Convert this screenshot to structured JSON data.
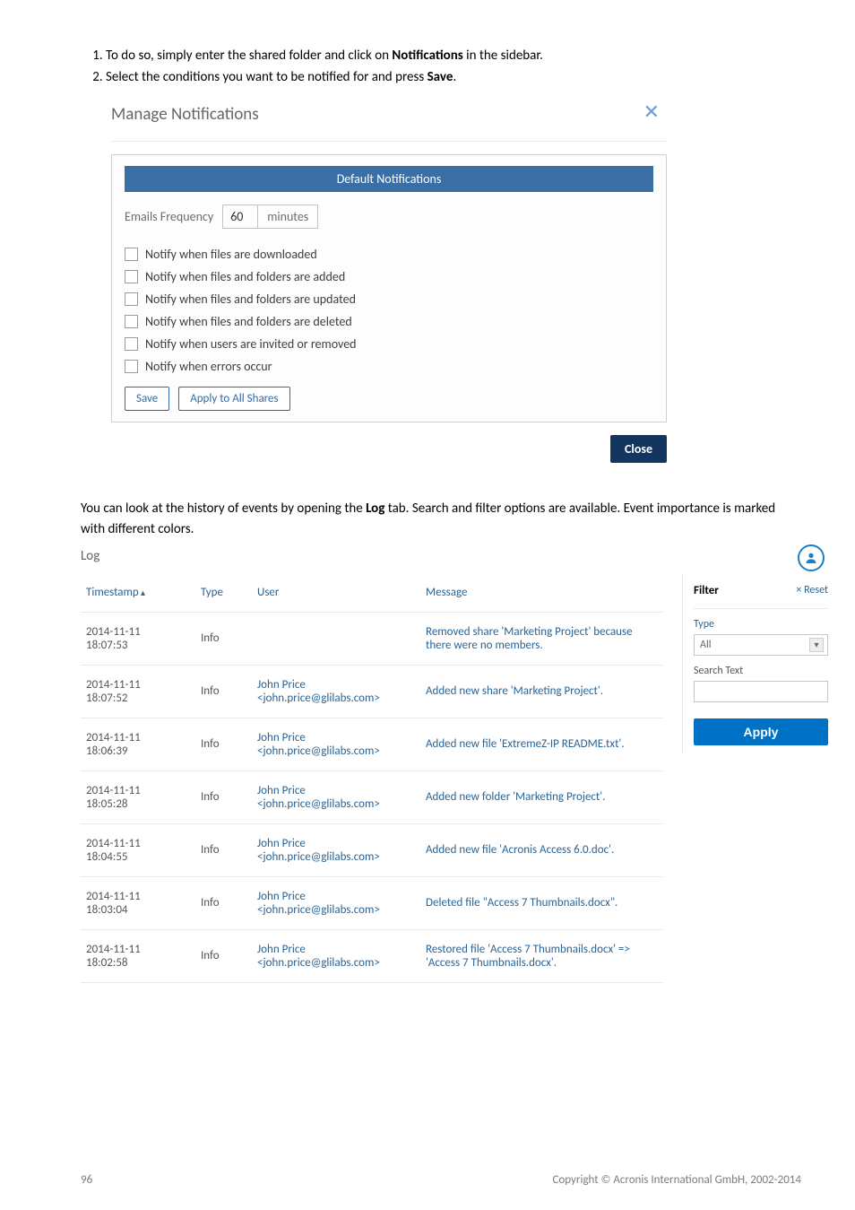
{
  "steps": [
    {
      "prefix": "To do so, simply enter the shared folder and click on ",
      "bold": "Notifications",
      "suffix": " in the sidebar."
    },
    {
      "prefix": "Select the conditions you want to be notified for and press ",
      "bold": "Save",
      "suffix": "."
    }
  ],
  "dialog": {
    "title": "Manage Notifications",
    "close_glyph": "✕",
    "panel_header": "Default Notifications",
    "freq_label": "Emails Frequency",
    "freq_value": "60",
    "freq_unit": "minutes",
    "checks": [
      "Notify when files are downloaded",
      "Notify when files and folders are added",
      "Notify when files and folders are updated",
      "Notify when files and folders are deleted",
      "Notify when users are invited or removed",
      "Notify when errors occur"
    ],
    "save_label": "Save",
    "apply_all_label": "Apply to All Shares",
    "close_label": "Close"
  },
  "paragraph": {
    "part1": "You can look at the history of events by opening the ",
    "bold": "Log",
    "part2": " tab. Search and filter options are available. Event importance is marked with different colors."
  },
  "log": {
    "title": "Log",
    "columns": {
      "timestamp": "Timestamp",
      "type": "Type",
      "user": "User",
      "message": "Message"
    },
    "user_name": "John Price",
    "user_mail": "<john.price@glilabs.com>",
    "rows": [
      {
        "ts_d": "2014-11-11",
        "ts_t": "18:07:53",
        "type": "Info",
        "user": false,
        "msg": "Removed share 'Marketing Project' because there were no members."
      },
      {
        "ts_d": "2014-11-11",
        "ts_t": "18:07:52",
        "type": "Info",
        "user": true,
        "msg": "Added new share 'Marketing Project'."
      },
      {
        "ts_d": "2014-11-11",
        "ts_t": "18:06:39",
        "type": "Info",
        "user": true,
        "msg": "Added new file 'ExtremeZ-IP README.txt'."
      },
      {
        "ts_d": "2014-11-11",
        "ts_t": "18:05:28",
        "type": "Info",
        "user": true,
        "msg": "Added new folder 'Marketing Project'."
      },
      {
        "ts_d": "2014-11-11",
        "ts_t": "18:04:55",
        "type": "Info",
        "user": true,
        "msg": "Added new file 'Acronis Access 6.0.doc'."
      },
      {
        "ts_d": "2014-11-11",
        "ts_t": "18:03:04",
        "type": "Info",
        "user": true,
        "msg": "Deleted file \"Access 7 Thumbnails.docx\"."
      },
      {
        "ts_d": "2014-11-11",
        "ts_t": "18:02:58",
        "type": "Info",
        "user": true,
        "msg": "Restored file 'Access 7 Thumbnails.docx' => 'Access 7 Thumbnails.docx'."
      }
    ]
  },
  "filter": {
    "title": "Filter",
    "reset": "× Reset",
    "type_label": "Type",
    "type_value": "All",
    "search_label": "Search Text",
    "apply": "Apply"
  },
  "footer": {
    "page": "96",
    "copyright": "Copyright © Acronis International GmbH, 2002-2014"
  }
}
